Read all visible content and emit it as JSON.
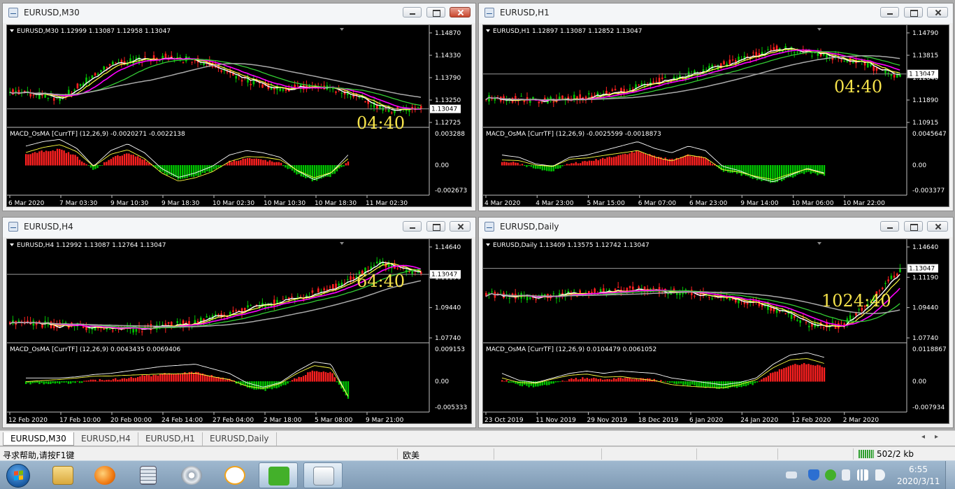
{
  "windows": [
    {
      "title": "EURUSD,M30",
      "close_active": true,
      "info": "EURUSD,M30  1.12999 1.13087 1.12958 1.13047",
      "timer": "04:40",
      "current_price": "1.13047",
      "prices": [
        "1.14870",
        "1.14330",
        "1.13790",
        "1.13250",
        "1.12725"
      ],
      "macd_label": "MACD_OsMA [CurrTF] (12,26,9) -0.0020271 -0.0022138",
      "macd_ticks": [
        "0.003288",
        "0.00",
        "-0.002673"
      ],
      "time_labels": [
        "6 Mar 2020",
        "7 Mar 03:30",
        "9 Mar 10:30",
        "9 Mar 18:30",
        "10 Mar 02:30",
        "10 Mar 10:30",
        "10 Mar 18:30",
        "11 Mar 02:30"
      ]
    },
    {
      "title": "EURUSD,H1",
      "close_active": false,
      "info": "EURUSD,H1  1.12897 1.13087 1.12852 1.13047",
      "timer": "04:40",
      "current_price": "1.13047",
      "prices": [
        "1.14790",
        "1.13815",
        "1.12840",
        "1.11890",
        "1.10915"
      ],
      "macd_label": "MACD_OsMA [CurrTF] (12,26,9) -0.0025599 -0.0018873",
      "macd_ticks": [
        "0.0045647",
        "0.00",
        "-0.003377"
      ],
      "time_labels": [
        "4 Mar 2020",
        "4 Mar 23:00",
        "5 Mar 15:00",
        "6 Mar 07:00",
        "6 Mar 23:00",
        "9 Mar 14:00",
        "10 Mar 06:00",
        "10 Mar 22:00"
      ]
    },
    {
      "title": "EURUSD,H4",
      "close_active": false,
      "info": "EURUSD,H4  1.12992 1.13087 1.12764 1.13047",
      "timer": "64:40",
      "current_price": "1.13047",
      "prices": [
        "1.14640",
        "1.11190",
        "1.09440",
        "1.07740"
      ],
      "macd_label": "MACD_OsMA [CurrTF] (12,26,9) 0.0043435 0.0069406",
      "macd_ticks": [
        "0.009153",
        "0.00",
        "-0.005333"
      ],
      "time_labels": [
        "12 Feb 2020",
        "17 Feb 10:00",
        "20 Feb 00:00",
        "24 Feb 14:00",
        "27 Feb 04:00",
        "2 Mar 18:00",
        "5 Mar 08:00",
        "9 Mar 21:00"
      ]
    },
    {
      "title": "EURUSD,Daily",
      "close_active": false,
      "info": "EURUSD,Daily  1.13409 1.13575 1.12742 1.13047",
      "timer": "1024:40",
      "current_price": "1.13047",
      "prices": [
        "1.14640",
        "1.11190",
        "1.09440",
        "1.07740"
      ],
      "macd_label": "MACD_OsMA [CurrTF] (12,26,9) 0.0104479 0.0061052",
      "macd_ticks": [
        "0.0118867",
        "0.00",
        "-0.007934"
      ],
      "time_labels": [
        "23 Oct 2019",
        "11 Nov 2019",
        "29 Nov 2019",
        "18 Dec 2019",
        "6 Jan 2020",
        "24 Jan 2020",
        "12 Feb 2020",
        "2 Mar 2020"
      ]
    }
  ],
  "tabs": [
    "EURUSD,M30",
    "EURUSD,H4",
    "EURUSD,H1",
    "EURUSD,Daily"
  ],
  "status": {
    "help": "寻求帮助,请按F1键",
    "profile": "欧美",
    "traffic": "502/2 kb"
  },
  "clock": {
    "time": "6:55",
    "date": "2020/3/11"
  },
  "colors": {
    "bull": "#00c400",
    "bear": "#ff2020",
    "ma_fast": "#ffffff",
    "ma_yellow": "#ffff40",
    "ma_magenta": "#ff00ff",
    "ma_green": "#33cc33",
    "ma_gray": "#a9a9a9",
    "timer": "#f5e24a"
  }
}
